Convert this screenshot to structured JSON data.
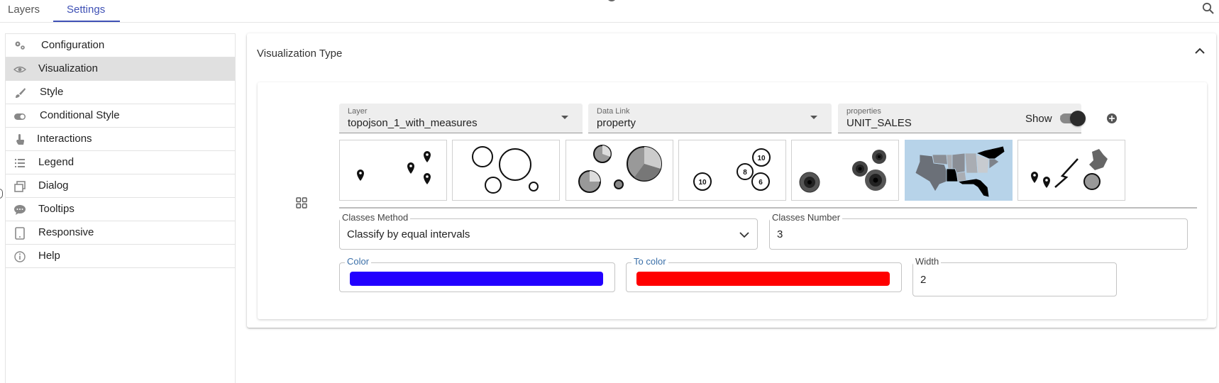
{
  "tabs": [
    {
      "label": "Layers",
      "active": false
    },
    {
      "label": "Settings",
      "active": true
    }
  ],
  "sidebar": {
    "items": [
      {
        "label": "Configuration",
        "icon": "gears-icon",
        "selected": false
      },
      {
        "label": "Visualization",
        "icon": "eye-icon",
        "selected": true
      },
      {
        "label": "Style",
        "icon": "brush-icon",
        "selected": false
      },
      {
        "label": "Conditional Style",
        "icon": "toggle-icon",
        "selected": false
      },
      {
        "label": "Interactions",
        "icon": "pointer-hand-icon",
        "selected": false
      },
      {
        "label": "Legend",
        "icon": "list-icon",
        "selected": false
      },
      {
        "label": "Dialog",
        "icon": "window-restore-icon",
        "selected": false
      },
      {
        "label": "Tooltips",
        "icon": "comment-icon",
        "selected": false
      },
      {
        "label": "Responsive",
        "icon": "tablet-icon",
        "selected": false
      },
      {
        "label": "Help",
        "icon": "info-icon",
        "selected": false
      }
    ]
  },
  "panel": {
    "title": "Visualization Type",
    "layer": {
      "label": "Layer",
      "value": "topojson_1_with_measures"
    },
    "data_link": {
      "label": "Data Link",
      "value": "property"
    },
    "properties": {
      "label": "properties",
      "value": "UNIT_SALES"
    },
    "show": {
      "label": "Show",
      "on": true
    },
    "viz_types": [
      {
        "name": "markers",
        "selected": false
      },
      {
        "name": "proportional-circles",
        "selected": false
      },
      {
        "name": "pie-charts",
        "selected": false
      },
      {
        "name": "labeled-circles",
        "selected": false,
        "labels": [
          "10",
          "8",
          "6",
          "10"
        ]
      },
      {
        "name": "ring-circles",
        "selected": false
      },
      {
        "name": "choropleth",
        "selected": true
      },
      {
        "name": "mixed-geometry",
        "selected": false
      }
    ],
    "classes_method": {
      "label": "Classes Method",
      "value": "Classify by equal intervals"
    },
    "classes_number": {
      "label": "Classes Number",
      "value": "3"
    },
    "color": {
      "label": "Color",
      "value": "#2200ff"
    },
    "to_color": {
      "label": "To color",
      "value": "#ff0000"
    },
    "width": {
      "label": "Width",
      "value": "2"
    }
  },
  "colors": {
    "accent": "#3f51b5",
    "selected_row": "#e0e0e0",
    "selected_tile": "#b7d3e9"
  }
}
